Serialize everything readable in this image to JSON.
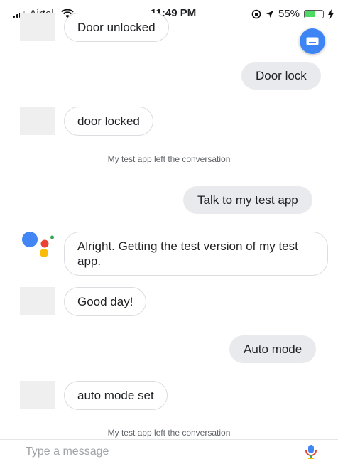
{
  "status_bar": {
    "carrier": "Airtel",
    "time": "11:49 PM",
    "battery": "55%",
    "battery_level": 0.55
  },
  "icons": {
    "keyboard": "keyboard-icon",
    "mic": "mic-icon",
    "assistant": "google-assistant-logo"
  },
  "messages": {
    "m1": "Door unlocked",
    "m2": "Door lock",
    "m3": "door locked",
    "note1": "My test app left the conversation",
    "m4": "Talk to my test app",
    "m5": "Alright. Getting the test version of my test app.",
    "m6": "Good day!",
    "m7": "Auto mode",
    "m8": "auto mode set",
    "note2": "My test app left the conversation"
  },
  "input": {
    "placeholder": "Type a message"
  },
  "colors": {
    "accent": "#3d84f5",
    "user_bubble": "#e8eaed",
    "bubble_border": "#dadce0"
  }
}
